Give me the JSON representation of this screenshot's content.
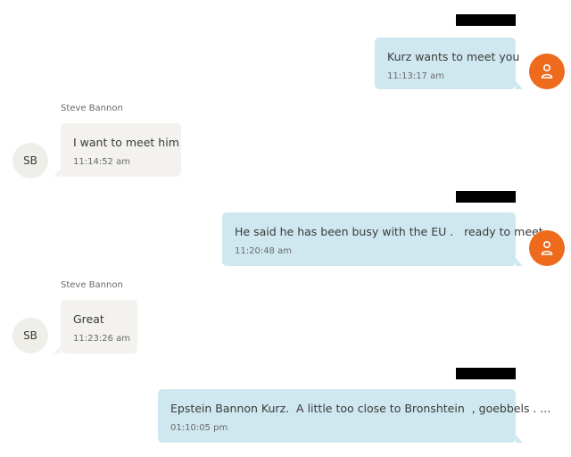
{
  "conversation": {
    "messages": [
      {
        "direction": "outgoing",
        "text": "Kurz wants to meet you",
        "time": "11:13:17 am",
        "sender_redacted": true
      },
      {
        "direction": "incoming",
        "sender": "Steve Bannon",
        "initials": "SB",
        "text": "I want to meet him",
        "time": "11:14:52 am"
      },
      {
        "direction": "outgoing",
        "text": "He said he has been busy with the EU .   ready to meet",
        "time": "11:20:48 am",
        "sender_redacted": true
      },
      {
        "direction": "incoming",
        "sender": "Steve Bannon",
        "initials": "SB",
        "text": "Great",
        "time": "11:23:26 am"
      },
      {
        "direction": "outgoing",
        "text": "Epstein Bannon Kurz.  A little too close to Bronshtein  , goebbels . ...",
        "time": "01:10:05 pm",
        "sender_redacted": true
      }
    ]
  },
  "icons": {
    "user_avatar": "person-icon"
  },
  "colors": {
    "outgoing_bubble": "#cfe8ef",
    "incoming_bubble": "#f3f2ee",
    "user_avatar": "#ee6a1c",
    "contact_avatar": "#efeee8",
    "redaction": "#000000"
  }
}
